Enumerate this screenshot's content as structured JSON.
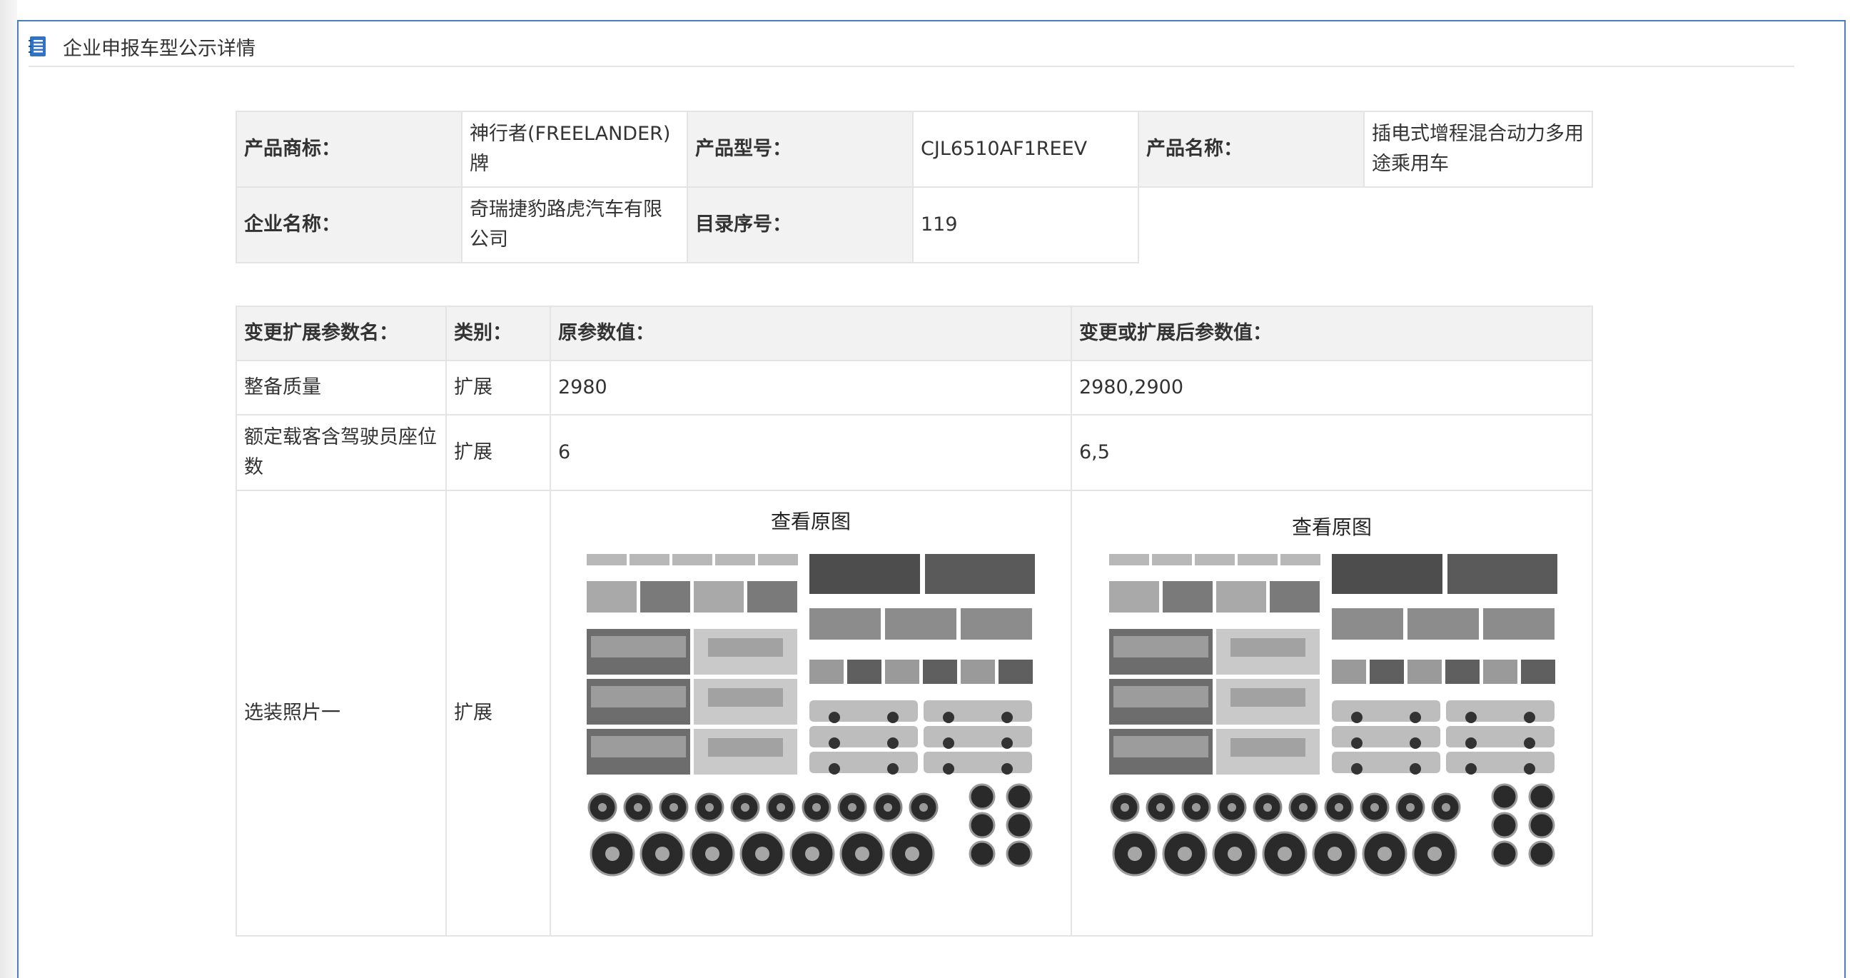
{
  "panel": {
    "title": "企业申报车型公示详情",
    "icon": "notebook-icon"
  },
  "info": {
    "brand_label": "产品商标：",
    "brand_value": "神行者(FREELANDER)牌",
    "model_label": "产品型号：",
    "model_value": "CJL6510AF1REEV",
    "name_label": "产品名称：",
    "name_value": "插电式增程混合动力多用途乘用车",
    "company_label": "企业名称：",
    "company_value": "奇瑞捷豹路虎汽车有限公司",
    "catalog_label": "目录序号：",
    "catalog_value": "119"
  },
  "params": {
    "headers": [
      "变更扩展参数名：",
      "类别：",
      "原参数值：",
      "变更或扩展后参数值："
    ],
    "rows": [
      {
        "name": "整备质量",
        "category": "扩展",
        "original": "2980",
        "changed": "2980,2900"
      },
      {
        "name": "额定载客含驾驶员座位数",
        "category": "扩展",
        "original": "6",
        "changed": "6,5"
      },
      {
        "name": "选装照片一",
        "category": "扩展",
        "original_link": "查看原图",
        "changed_link": "查看原图"
      }
    ]
  },
  "colors": {
    "frame_border": "#4a7fbd",
    "label_bg": "#f2f2f2",
    "cell_border": "#e4e4e4",
    "icon_blue": "#2f73c9"
  }
}
